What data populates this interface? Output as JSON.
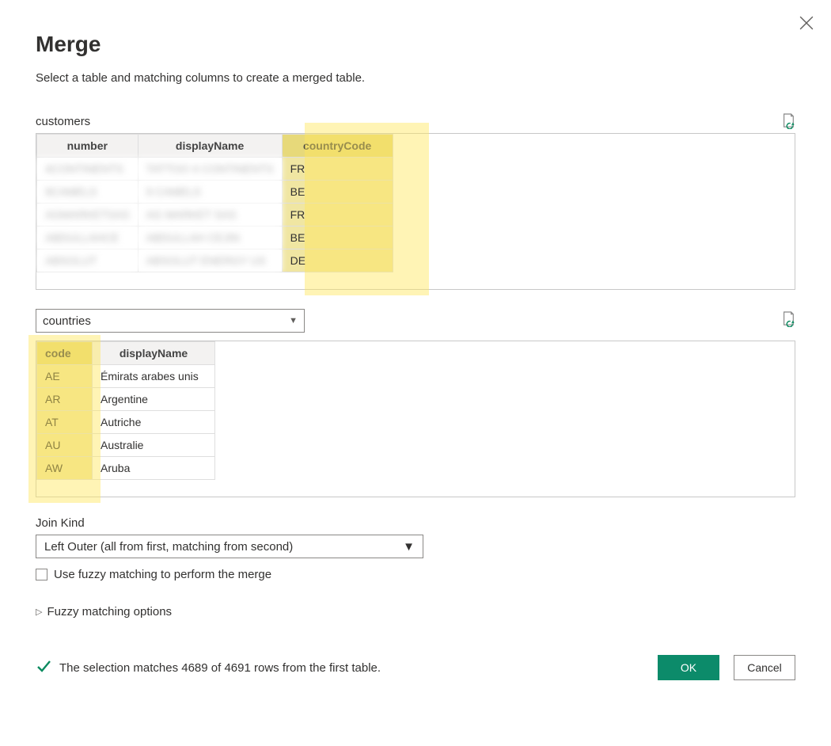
{
  "dialog": {
    "title": "Merge",
    "subtitle": "Select a table and matching columns to create a merged table."
  },
  "table1": {
    "label": "customers",
    "columns": [
      "number",
      "displayName",
      "countryCode"
    ],
    "selectedColumnIndex": 2,
    "rows": [
      {
        "number": "4CONTINENTS",
        "displayName": "TATTOO 4 CONTINENTS",
        "countryCode": "FR"
      },
      {
        "number": "9CAMELS",
        "displayName": "9 CAMELS",
        "countryCode": "BE"
      },
      {
        "number": "AGMARKETSAS",
        "displayName": "AG MARKET SAS",
        "countryCode": "FR"
      },
      {
        "number": "ABDULLAHCE",
        "displayName": "ABDULLAH CEJIN",
        "countryCode": "BE"
      },
      {
        "number": "ABSOLUT",
        "displayName": "ABSOLUT ENERGY US",
        "countryCode": "DE"
      }
    ]
  },
  "table2": {
    "dropdownValue": "countries",
    "columns": [
      "code",
      "displayName"
    ],
    "selectedColumnIndex": 0,
    "rows": [
      {
        "code": "AE",
        "displayName": "Émirats arabes unis"
      },
      {
        "code": "AR",
        "displayName": "Argentine"
      },
      {
        "code": "AT",
        "displayName": "Autriche"
      },
      {
        "code": "AU",
        "displayName": "Australie"
      },
      {
        "code": "AW",
        "displayName": "Aruba"
      }
    ]
  },
  "joinKind": {
    "label": "Join Kind",
    "value": "Left Outer (all from first, matching from second)"
  },
  "fuzzy": {
    "checkboxLabel": "Use fuzzy matching to perform the merge",
    "expandoLabel": "Fuzzy matching options"
  },
  "status": {
    "text": "The selection matches 4689 of 4691 rows from the first table."
  },
  "buttons": {
    "ok": "OK",
    "cancel": "Cancel"
  }
}
